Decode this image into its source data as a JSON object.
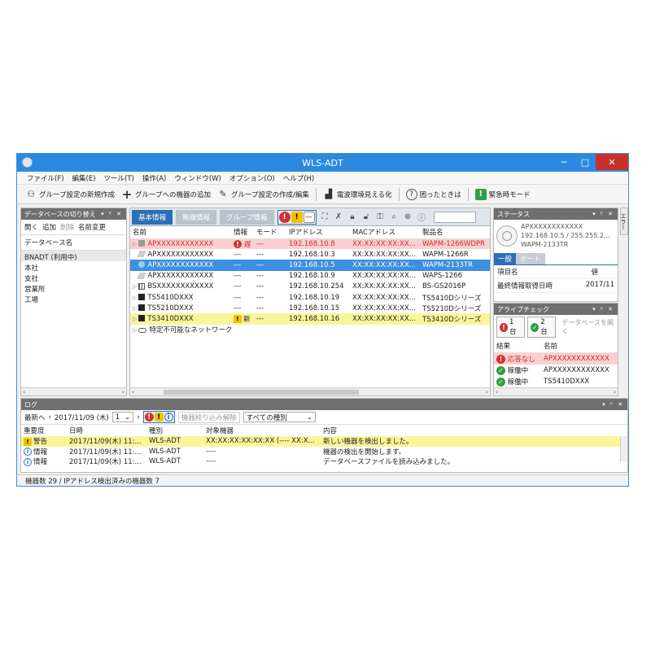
{
  "window": {
    "title": "WLS-ADT",
    "min": "─",
    "max": "□",
    "close": "✕"
  },
  "menu": [
    "ファイル(F)",
    "編集(E)",
    "ツール(T)",
    "操作(A)",
    "ウィンドウ(W)",
    "オプション(O)",
    "ヘルプ(H)"
  ],
  "toolbar": {
    "new_group": "グループ設定の新規作成",
    "add_device": "グループへの機器の追加",
    "edit_group": "グループ設定の作成/編集",
    "visualize": "電波環境見える化",
    "help": "困ったときは",
    "emergency": "緊急時モード"
  },
  "left": {
    "header": "データベースの切り替え",
    "actions": {
      "open": "開く",
      "add": "追加",
      "delete": "削除",
      "rename": "名前変更"
    },
    "col": "データベース名",
    "items": [
      "BNADT (利用中)",
      "本社",
      "支社",
      "営業所",
      "工場"
    ]
  },
  "center": {
    "tabs": [
      "基本情報",
      "無線情報",
      "グループ情報"
    ],
    "columns": [
      "名前",
      "情報",
      "モード",
      "IPアドレス",
      "MACアドレス",
      "製品名"
    ],
    "rows": [
      {
        "name": "APXXXXXXXXXXXX",
        "info": "遅",
        "mode": "---",
        "ip": "192.168.10.8",
        "mac": "XX:XX:XX:XX:XX...",
        "product": "WAPM-1266WDPR"
      },
      {
        "name": "APXXXXXXXXXXXX",
        "info": "---",
        "mode": "---",
        "ip": "192.168.10.3",
        "mac": "XX:XX:XX:XX:XX...",
        "product": "WAPM-1266R"
      },
      {
        "name": "APXXXXXXXXXXXX",
        "info": "---",
        "mode": "---",
        "ip": "192.168.10.5",
        "mac": "XX:XX:XX:XX:XX...",
        "product": "WAPM-2133TR"
      },
      {
        "name": "APXXXXXXXXXXXX",
        "info": "---",
        "mode": "---",
        "ip": "192.168.10.9",
        "mac": "XX:XX:XX:XX:XX...",
        "product": "WAPS-1266"
      },
      {
        "name": "BSXXXXXXXXXXXX",
        "info": "---",
        "mode": "---",
        "ip": "192.168.10.254",
        "mac": "XX:XX:XX:XX:XX...",
        "product": "BS-GS2016P"
      },
      {
        "name": "TS5410DXXX",
        "info": "---",
        "mode": "---",
        "ip": "192.168.10.19",
        "mac": "XX:XX:XX:XX:XX...",
        "product": "TS5410Dシリーズ"
      },
      {
        "name": "TS5210DXXX",
        "info": "---",
        "mode": "---",
        "ip": "192.168.10.15",
        "mac": "XX:XX:XX:XX:XX...",
        "product": "TS5210Dシリーズ"
      },
      {
        "name": "TS3410DXXX",
        "info": "新",
        "mode": "---",
        "ip": "192.168.10.16",
        "mac": "XX:XX:XX:XX:XX...",
        "product": "TS3410Dシリーズ"
      }
    ],
    "unknown_network": "特定不可能なネットワーク"
  },
  "status": {
    "header": "ステータス",
    "name": "APXXXXXXXXXXXX",
    "ip": "192.168.10.5 / 255.255.2...",
    "model": "WAPM-2133TR",
    "tabs": [
      "一般",
      "ポート"
    ],
    "col_item": "項目名",
    "col_value": "値",
    "row_label": "最終情報取得日時",
    "row_value": "2017/11"
  },
  "alive": {
    "header": "アライブチェック",
    "err_count": "1 台",
    "ok_count": "2 台",
    "db_open": "データベースを開く",
    "col_result": "結果",
    "col_name": "名前",
    "rows": [
      {
        "result": "応答なし",
        "name": "APXXXXXXXXXXXX"
      },
      {
        "result": "稼働中",
        "name": "APXXXXXXXXXXXX"
      },
      {
        "result": "稼働中",
        "name": "TS5410DXXX"
      }
    ]
  },
  "side_tab": "エラー",
  "log": {
    "header": "ログ",
    "latest": "最新へ",
    "date": "2017/11/09 (木)",
    "page": "1",
    "clear_filter": "機器絞り込み解除",
    "type_filter": "すべての種別",
    "columns": [
      "重要度",
      "日時",
      "種別",
      "対象機器",
      "内容"
    ],
    "rows": [
      {
        "level": "警告",
        "time": "2017/11/09(木) 11:...",
        "kind": "WLS-ADT",
        "target": "XX:XX:XX:XX:XX:XX (---- XX:X...",
        "content": "新しい機器を検出しました。"
      },
      {
        "level": "情報",
        "time": "2017/11/09(木) 11:...",
        "kind": "WLS-ADT",
        "target": "----",
        "content": "機器の検出を開始します。"
      },
      {
        "level": "情報",
        "time": "2017/11/09(木) 11:...",
        "kind": "WLS-ADT",
        "target": "----",
        "content": "データベースファイルを読み込みました。"
      }
    ]
  },
  "statusbar": "機器数 29 / IPアドレス検出済みの機器数 7"
}
